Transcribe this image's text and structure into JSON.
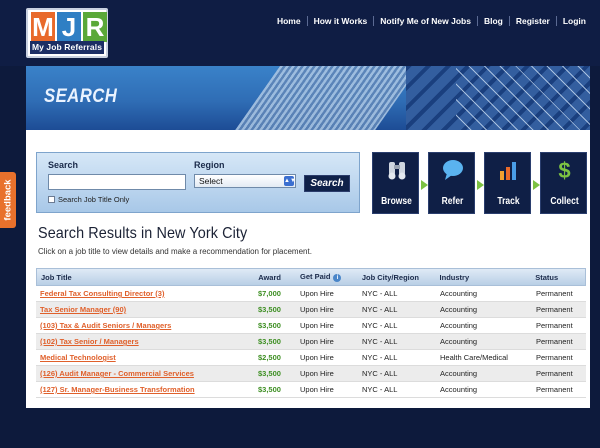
{
  "logo": {
    "letters": [
      "M",
      "J",
      "R"
    ],
    "subtitle": "My Job Referrals"
  },
  "topnav": [
    "Home",
    "How it Works",
    "Notify Me of New Jobs",
    "Blog",
    "Register",
    "Login"
  ],
  "banner": {
    "title": "SEARCH"
  },
  "feedback": "feedback",
  "search": {
    "search_label": "Search",
    "search_value": "",
    "region_label": "Region",
    "region_selected": "Select",
    "button": "Search",
    "checkbox_label": "Search Job Title Only"
  },
  "steps": [
    {
      "label": "Browse",
      "icon": "binoculars-icon"
    },
    {
      "label": "Refer",
      "icon": "speech-bubble-icon"
    },
    {
      "label": "Track",
      "icon": "bar-chart-icon"
    },
    {
      "label": "Collect",
      "icon": "dollar-icon"
    }
  ],
  "results": {
    "title": "Search Results in New York City",
    "subtitle": "Click on a job title to view details and make a recommendation for placement.",
    "headers": [
      "Job Title",
      "Award",
      "Get Paid",
      "Job City/Region",
      "Industry",
      "Status"
    ],
    "rows": [
      [
        "Federal Tax Consulting Director (3)",
        "$7,000",
        "Upon Hire",
        "NYC - ALL",
        "Accounting",
        "Permanent"
      ],
      [
        "Tax Senior Manager (90)",
        "$3,500",
        "Upon Hire",
        "NYC - ALL",
        "Accounting",
        "Permanent"
      ],
      [
        "(103) Tax & Audit Seniors / Managers",
        "$3,500",
        "Upon Hire",
        "NYC - ALL",
        "Accounting",
        "Permanent"
      ],
      [
        "(102) Tax Senior / Managers",
        "$3,500",
        "Upon Hire",
        "NYC - ALL",
        "Accounting",
        "Permanent"
      ],
      [
        "Medical Technologist",
        "$2,500",
        "Upon Hire",
        "NYC - ALL",
        "Health Care/Medical",
        "Permanent"
      ],
      [
        "(126) Audit Manager - Commercial Services",
        "$3,500",
        "Upon Hire",
        "NYC - ALL",
        "Accounting",
        "Permanent"
      ],
      [
        "(127) Sr. Manager-Business Transformation",
        "$3,500",
        "Upon Hire",
        "NYC - ALL",
        "Accounting",
        "Permanent"
      ]
    ]
  }
}
